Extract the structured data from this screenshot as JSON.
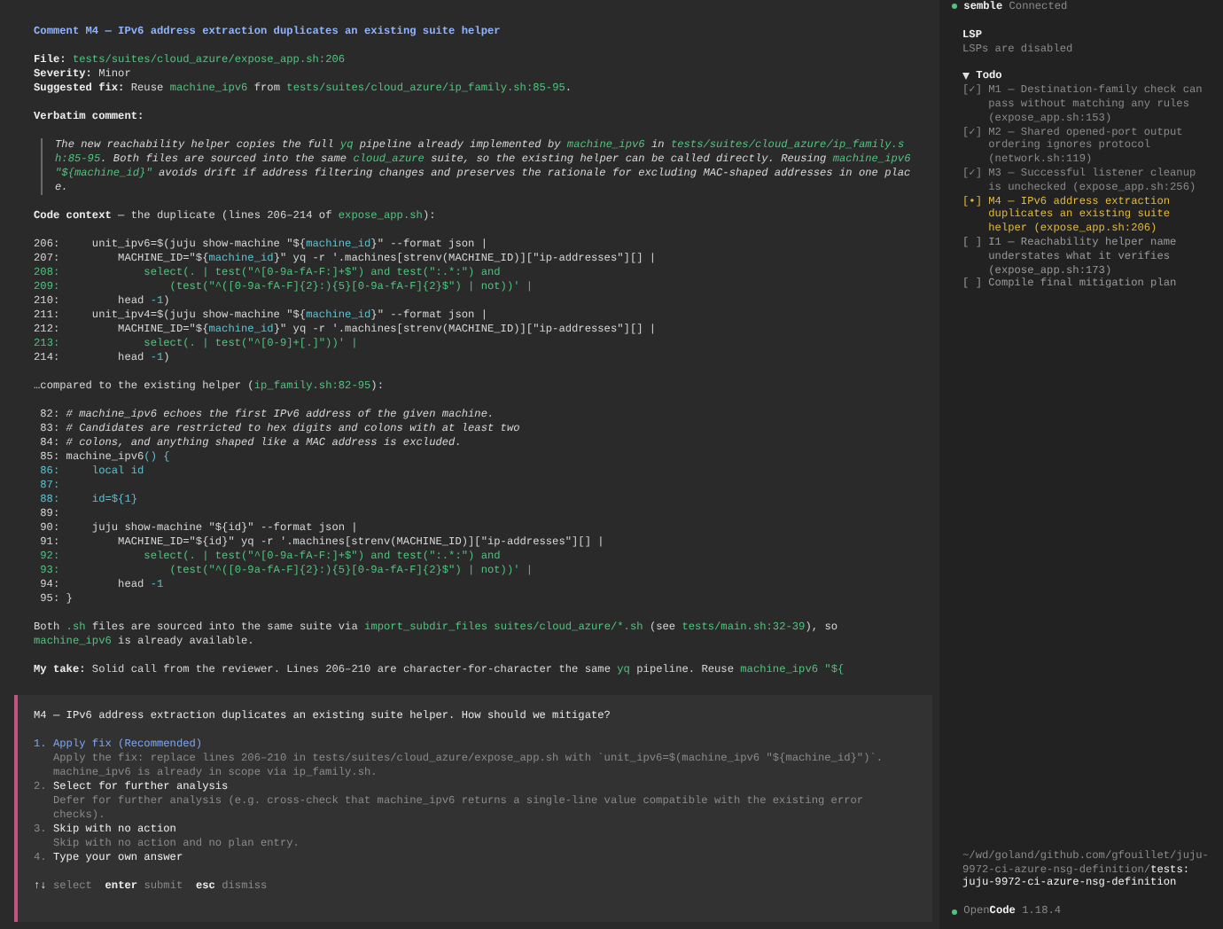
{
  "main": {
    "title": "Comment M4 — IPv6 address extraction duplicates an existing suite helper",
    "blocks": [
      {
        "kind": "lines",
        "lines": [
          [
            {
              "kind": "bold",
              "text": "File:"
            },
            {
              "kind": "code",
              "text": " tests/suites/cloud_azure/expose_app.sh:206"
            }
          ],
          [
            {
              "kind": "bold",
              "text": "Severity:"
            },
            {
              "kind": "plain",
              "text": " Minor"
            }
          ],
          [
            {
              "kind": "bold",
              "text": "Suggested fix:"
            },
            {
              "kind": "plain",
              "text": " Reuse "
            },
            {
              "kind": "code",
              "text": "machine_ipv6"
            },
            {
              "kind": "plain",
              "text": " from "
            },
            {
              "kind": "code",
              "text": "tests/suites/cloud_azure/ip_family.sh:85-95"
            },
            {
              "kind": "plain",
              "text": "."
            }
          ]
        ]
      },
      {
        "kind": "lines",
        "lines": [
          [
            {
              "kind": "bold",
              "text": "Verbatim comment:"
            }
          ]
        ]
      },
      {
        "kind": "quote",
        "segments": [
          {
            "kind": "plain",
            "text": "The new reachability helper copies the full "
          },
          {
            "kind": "code",
            "text": "yq"
          },
          {
            "kind": "plain",
            "text": " pipeline already implemented by "
          },
          {
            "kind": "code",
            "text": "machine_ipv6"
          },
          {
            "kind": "plain",
            "text": " in "
          },
          {
            "kind": "code",
            "text": "tests/suites/cloud_azure/ip_family.sh:85-95"
          },
          {
            "kind": "plain",
            "text": ". Both files are sourced into the same "
          },
          {
            "kind": "code",
            "text": "cloud_azure"
          },
          {
            "kind": "plain",
            "text": " suite, so the existing helper can be called directly. Reusing "
          },
          {
            "kind": "code",
            "text": "machine_ipv6 \"${machine_id}\""
          },
          {
            "kind": "plain",
            "text": " avoids drift if address filtering changes and preserves the rationale for excluding MAC-shaped addresses in one place."
          }
        ]
      },
      {
        "kind": "lines",
        "lines": [
          [
            {
              "kind": "bold",
              "text": "Code context"
            },
            {
              "kind": "plain",
              "text": " — the duplicate (lines 206–214 of "
            },
            {
              "kind": "code",
              "text": "expose_app.sh"
            },
            {
              "kind": "plain",
              "text": "):"
            }
          ]
        ]
      },
      {
        "kind": "code",
        "lines": [
          {
            "number": "206:",
            "kind": "plain",
            "segments": [
              {
                "kind": "plain",
                "text": "    unit_ipv6=$(juju show-machine \"${"
              },
              {
                "kind": "var",
                "text": "machine_id"
              },
              {
                "kind": "plain",
                "text": "}\" --format json |"
              }
            ]
          },
          {
            "number": "207:",
            "kind": "plain",
            "segments": [
              {
                "kind": "plain",
                "text": "        MACHINE_ID=\"${"
              },
              {
                "kind": "var",
                "text": "machine_id"
              },
              {
                "kind": "plain",
                "text": "}\" yq -r '.machines[strenv(MACHINE_ID)][\"ip-addresses\"][] |"
              }
            ]
          },
          {
            "number": "208:",
            "kind": "string",
            "segments": [
              {
                "kind": "plain",
                "text": "            select(. | test(\"^[0-9a-fA-F:]+$\") and test(\":.*:\") and"
              }
            ]
          },
          {
            "number": "209:",
            "kind": "string",
            "segments": [
              {
                "kind": "plain",
                "text": "                (test(\"^([0-9a-fA-F]{2}:){5}[0-9a-fA-F]{2}$\") | not))' |"
              }
            ]
          },
          {
            "number": "210:",
            "kind": "plain",
            "segments": [
              {
                "kind": "plain",
                "text": "        head "
              },
              {
                "kind": "var",
                "text": "-1"
              },
              {
                "kind": "plain",
                "text": ")"
              }
            ]
          },
          {
            "number": "211:",
            "kind": "plain",
            "segments": [
              {
                "kind": "plain",
                "text": "    unit_ipv4=$(juju show-machine \"${"
              },
              {
                "kind": "var",
                "text": "machine_id"
              },
              {
                "kind": "plain",
                "text": "}\" --format json |"
              }
            ]
          },
          {
            "number": "212:",
            "kind": "plain",
            "segments": [
              {
                "kind": "plain",
                "text": "        MACHINE_ID=\"${"
              },
              {
                "kind": "var",
                "text": "machine_id"
              },
              {
                "kind": "plain",
                "text": "}\" yq -r '.machines[strenv(MACHINE_ID)][\"ip-addresses\"][] |"
              }
            ]
          },
          {
            "number": "213:",
            "kind": "string",
            "segments": [
              {
                "kind": "plain",
                "text": "            select(. | test(\"^[0-9]+[.]\"))' |"
              }
            ]
          },
          {
            "number": "214:",
            "kind": "plain",
            "segments": [
              {
                "kind": "plain",
                "text": "        head "
              },
              {
                "kind": "var",
                "text": "-1"
              },
              {
                "kind": "plain",
                "text": ")"
              }
            ]
          }
        ]
      },
      {
        "kind": "lines",
        "lines": [
          [
            {
              "kind": "plain",
              "text": "…compared to the existing helper ("
            },
            {
              "kind": "code",
              "text": "ip_family.sh:82-95"
            },
            {
              "kind": "plain",
              "text": "):"
            }
          ]
        ]
      },
      {
        "kind": "code",
        "lines": [
          {
            "number": "82:",
            "kind": "comment",
            "segments": [
              {
                "kind": "plain",
                "text": "# machine_ipv6 echoes the first IPv6 address of the given machine."
              }
            ]
          },
          {
            "number": "83:",
            "kind": "comment",
            "segments": [
              {
                "kind": "plain",
                "text": "# Candidates are restricted to hex digits and colons with at least two"
              }
            ]
          },
          {
            "number": "84:",
            "kind": "comment",
            "segments": [
              {
                "kind": "plain",
                "text": "# colons, and anything shaped like a MAC address is excluded."
              }
            ]
          },
          {
            "number": "85:",
            "kind": "plain",
            "segments": [
              {
                "kind": "plain",
                "text": "machine_ipv6"
              },
              {
                "kind": "var",
                "text": "() {"
              }
            ]
          },
          {
            "number": "86:",
            "kind": "local",
            "segments": [
              {
                "kind": "plain",
                "text": "    local id"
              }
            ]
          },
          {
            "number": "87:",
            "kind": "local"
          },
          {
            "number": "88:",
            "kind": "local",
            "segments": [
              {
                "kind": "plain",
                "text": "    id=${1}"
              }
            ]
          },
          {
            "number": "89:",
            "kind": "plain"
          },
          {
            "number": "90:",
            "kind": "plain",
            "segments": [
              {
                "kind": "plain",
                "text": "    juju show-machine \"${id}\" --format json |"
              }
            ]
          },
          {
            "number": "91:",
            "kind": "plain",
            "segments": [
              {
                "kind": "plain",
                "text": "        MACHINE_ID=\"${id}\" yq -r '.machines[strenv(MACHINE_ID)][\"ip-addresses\"][] |"
              }
            ]
          },
          {
            "number": "92:",
            "kind": "string",
            "segments": [
              {
                "kind": "plain",
                "text": "            select(. | test(\"^[0-9a-fA-F:]+$\") and test(\":.*:\") and"
              }
            ]
          },
          {
            "number": "93:",
            "kind": "string",
            "segments": [
              {
                "kind": "plain",
                "text": "                (test(\"^([0-9a-fA-F]{2}:){5}[0-9a-fA-F]{2}$\") | not))' |"
              }
            ]
          },
          {
            "number": "94:",
            "kind": "plain",
            "segments": [
              {
                "kind": "plain",
                "text": "        head "
              },
              {
                "kind": "var",
                "text": "-1"
              }
            ]
          },
          {
            "number": "95:",
            "kind": "plain",
            "segments": [
              {
                "kind": "plain",
                "text": "}"
              }
            ]
          }
        ]
      },
      {
        "kind": "lines",
        "lines": [
          [
            {
              "kind": "plain",
              "text": "Both "
            },
            {
              "kind": "code",
              "text": ".sh"
            },
            {
              "kind": "plain",
              "text": " files are sourced into the same suite via "
            },
            {
              "kind": "code",
              "text": "import_subdir_files suites/cloud_azure/*.sh"
            },
            {
              "kind": "plain",
              "text": " (see "
            },
            {
              "kind": "code",
              "text": "tests/main.sh:32-39"
            },
            {
              "kind": "plain",
              "text": "), so "
            },
            {
              "kind": "code",
              "text": "machine_ipv6"
            },
            {
              "kind": "plain",
              "text": " is already available."
            }
          ]
        ]
      },
      {
        "kind": "lines",
        "lines": [
          [
            {
              "kind": "bold",
              "text": "My take:"
            },
            {
              "kind": "plain",
              "text": " Solid call from the reviewer. Lines 206–210 are character-for-character the same "
            },
            {
              "kind": "code",
              "text": "yq"
            },
            {
              "kind": "plain",
              "text": " pipeline. Reuse "
            },
            {
              "kind": "code",
              "text": "machine_ipv6 \"${"
            }
          ]
        ]
      }
    ]
  },
  "question": {
    "prompt": "M4 — IPv6 address extraction duplicates an existing suite helper. How should we mitigate?",
    "options": [
      {
        "number": "1.",
        "label": "Apply fix (Recommended)",
        "description": "Apply the fix: replace lines 206–210 in tests/suites/cloud_azure/expose_app.sh with `unit_ipv6=$(machine_ipv6 \"${machine_id}\")`. machine_ipv6 is already in scope via ip_family.sh.",
        "selected": true
      },
      {
        "number": "2.",
        "label": "Select for further analysis",
        "description": "Defer for further analysis (e.g. cross-check that machine_ipv6 returns a single-line value compatible with the existing error checks).",
        "selected": false
      },
      {
        "number": "3.",
        "label": "Skip with no action",
        "description": "Skip with no action and no plan entry.",
        "selected": false
      },
      {
        "number": "4.",
        "label": "Type your own answer",
        "selected": false
      }
    ],
    "hints": [
      {
        "key": "↑↓",
        "action": "select"
      },
      {
        "key": "enter",
        "action": "submit"
      },
      {
        "key": "esc",
        "action": "dismiss"
      }
    ]
  },
  "sidebar": {
    "mcp": {
      "name": "semble",
      "status": "Connected"
    },
    "lsp": {
      "title": "LSP",
      "message": "LSPs are disabled"
    },
    "todo": {
      "title": "Todo",
      "expanded": true,
      "items": [
        {
          "marker": "[✓]",
          "done": true,
          "in_progress": false,
          "text": "M1 — Destination-family check can pass without matching any rules (expose_app.sh:153)"
        },
        {
          "marker": "[✓]",
          "done": true,
          "in_progress": false,
          "text": "M2 — Shared opened-port output ordering ignores protocol (network.sh:119)"
        },
        {
          "marker": "[✓]",
          "done": true,
          "in_progress": false,
          "text": "M3 — Successful listener cleanup is unchecked (expose_app.sh:256)"
        },
        {
          "marker": "[•]",
          "done": false,
          "in_progress": true,
          "text": "M4 — IPv6 address extraction duplicates an existing suite helper (expose_app.sh:206)"
        },
        {
          "marker": "[ ]",
          "done": false,
          "in_progress": false,
          "text": "I1 — Reachability helper name understates what it verifies (expose_app.sh:173)"
        },
        {
          "marker": "[ ]",
          "done": false,
          "in_progress": false,
          "text": "Compile final mitigation plan"
        }
      ]
    },
    "directory": {
      "path": "~/wd/goland/github.com/gfouillet/juju-9972-ci-azure-nsg-definition/",
      "folder": "tests:",
      "branch": "juju-9972-ci-azure-nsg-definition"
    },
    "app": {
      "name_muted": "Open",
      "name_bold": "Code",
      "version": "1.18.4"
    }
  }
}
